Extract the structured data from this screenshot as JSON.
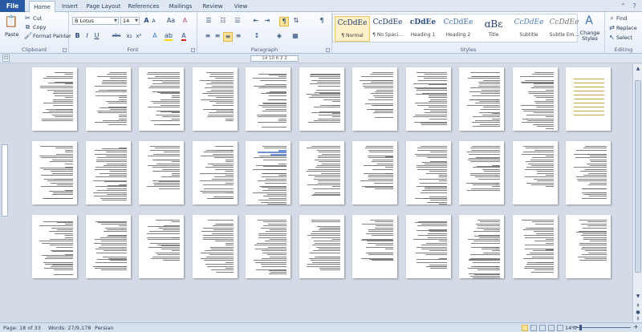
{
  "tabs": [
    "File",
    "Home",
    "Insert",
    "Page Layout",
    "References",
    "Mailings",
    "Review",
    "View"
  ],
  "active_tab": "Home",
  "clipboard": {
    "paste_label": "Paste",
    "cut_label": "Cut",
    "copy_label": "Copy",
    "format_painter_label": "Format Painter",
    "group_label": "Clipboard"
  },
  "font": {
    "name": "B Lotus",
    "size": "14",
    "group_label": "Font",
    "bold": "B",
    "italic": "I",
    "underline": "U",
    "strike": "abc",
    "subscript": "x₂",
    "superscript": "x²",
    "grow": "A",
    "shrink": "A",
    "change_case": "Aa",
    "clear": "A",
    "font_color": "A"
  },
  "paragraph": {
    "group_label": "Paragraph",
    "show_marks": "¶"
  },
  "styles": {
    "group_label": "Styles",
    "items": [
      {
        "sample": "CcDdEe",
        "name": "¶ Normal"
      },
      {
        "sample": "CcDdEe",
        "name": "¶ No Spaci..."
      },
      {
        "sample": "cDdEe",
        "name": "Heading 1"
      },
      {
        "sample": "CcDdEe",
        "name": "Heading 2"
      },
      {
        "sample": "ɑBɛ",
        "name": "Title"
      },
      {
        "sample": "CcDdEe",
        "name": "Subtitle"
      },
      {
        "sample": "CcDdEe",
        "name": "Subtle Em..."
      }
    ],
    "change_styles": "Change Styles"
  },
  "editing": {
    "group_label": "Editing",
    "find": "Find",
    "replace": "Replace",
    "select": "Select"
  },
  "ruler": {
    "text": "14 10 6 2 2"
  },
  "status": {
    "page": "Page: 18 of 33",
    "words": "Words: 27/9,178",
    "language": "Persian",
    "zoom": "14%"
  },
  "colors": {
    "file_tab": "#2a5aa6",
    "ribbon": "#fbfcfe",
    "doc_bg": "#d4dbe6"
  }
}
